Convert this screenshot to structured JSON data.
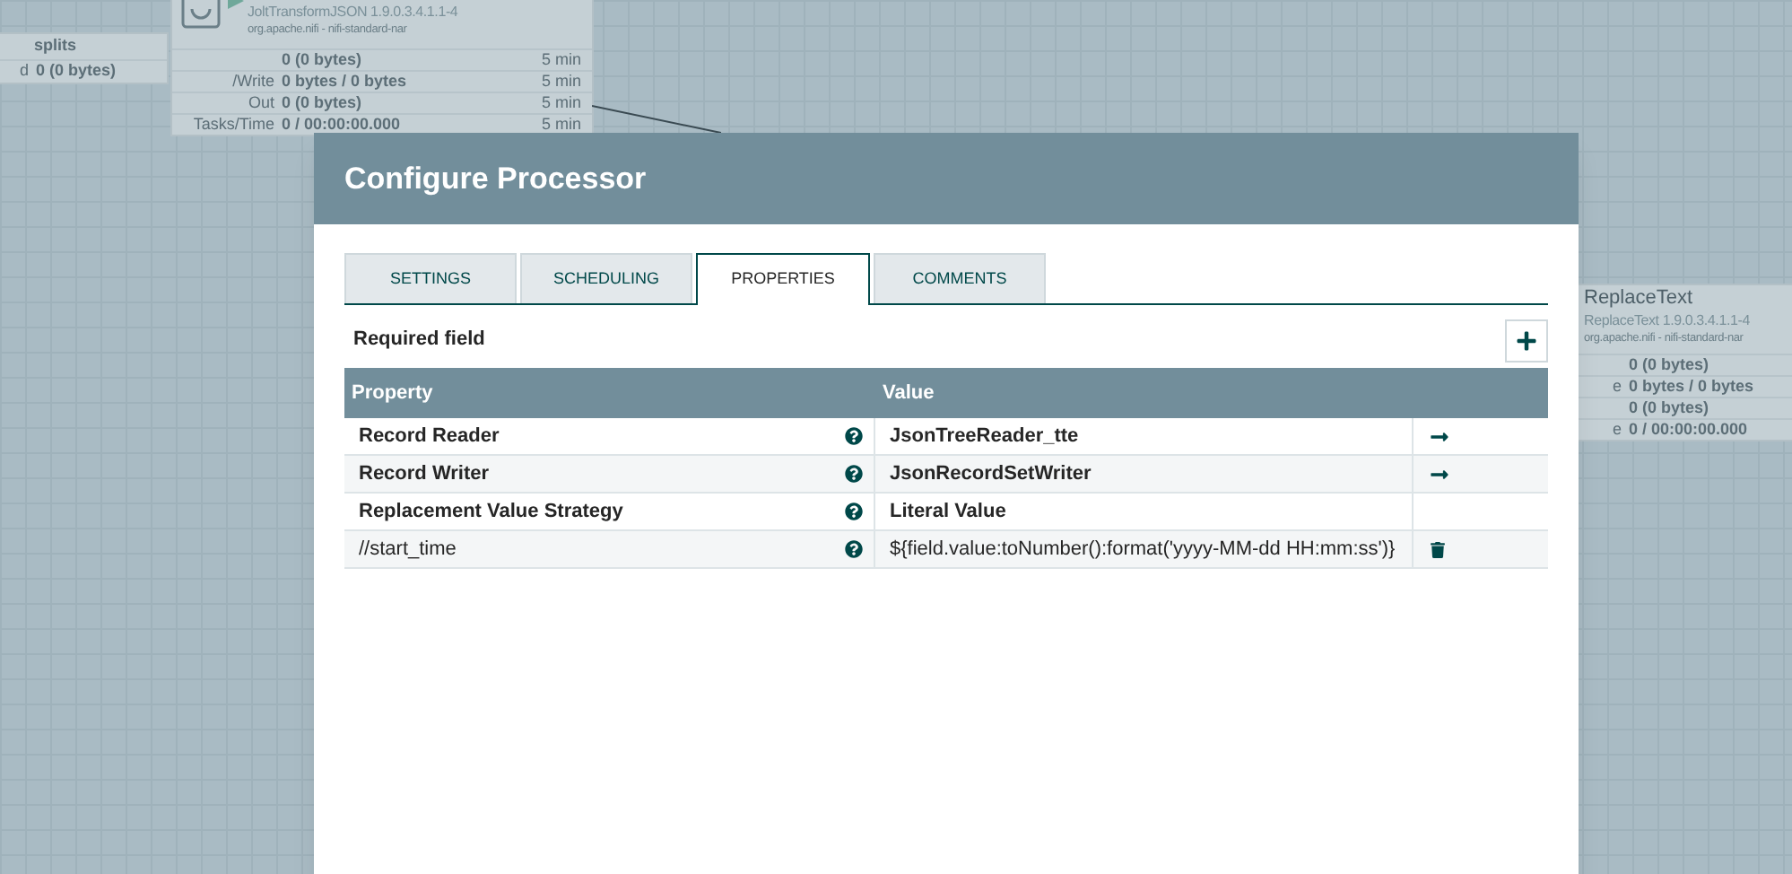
{
  "canvas": {
    "connection": {
      "name": "splits",
      "queued_label": "d",
      "queued_value": "0 (0 bytes)"
    },
    "processors": [
      {
        "type": "JoltTransformJSON 1.9.0.3.4.1.1-4",
        "bundle": "org.apache.nifi - nifi-standard-nar",
        "stats": [
          {
            "value": "0 (0 bytes)",
            "time": "5 min"
          },
          {
            "label": "/Write",
            "value": "0 bytes / 0 bytes",
            "time": "5 min"
          },
          {
            "label": "Out",
            "value": "0 (0 bytes)",
            "time": "5 min"
          },
          {
            "label": "Tasks/Time",
            "value": "0 / 00:00:00.000",
            "time": "5 min"
          }
        ]
      },
      {
        "name": "ReplaceText",
        "type": "ReplaceText 1.9.0.3.4.1.1-4",
        "bundle": "org.apache.nifi - nifi-standard-nar",
        "stats": [
          {
            "value": "0 (0 bytes)"
          },
          {
            "label": "e",
            "value": "0 bytes / 0 bytes"
          },
          {
            "value": "0 (0 bytes)"
          },
          {
            "label": "e",
            "value": "0 / 00:00:00.000"
          }
        ]
      }
    ]
  },
  "dialog": {
    "title": "Configure Processor",
    "tabs": [
      {
        "label": "SETTINGS",
        "selected": false
      },
      {
        "label": "SCHEDULING",
        "selected": false
      },
      {
        "label": "PROPERTIES",
        "selected": true
      },
      {
        "label": "COMMENTS",
        "selected": false
      }
    ],
    "required_note": "Required field",
    "table": {
      "columns": [
        "Property",
        "Value"
      ],
      "rows": [
        {
          "property": "Record Reader",
          "required": true,
          "value": "JsonTreeReader_tte",
          "has_link": true,
          "removable": false
        },
        {
          "property": "Record Writer",
          "required": true,
          "value": "JsonRecordSetWriter",
          "has_link": true,
          "removable": false
        },
        {
          "property": "Replacement Value Strategy",
          "required": true,
          "value": "Literal Value",
          "has_link": false,
          "removable": false
        },
        {
          "property": "//start_time",
          "required": false,
          "value": "${field.value:toNumber():format('yyyy-MM-dd HH:mm:ss')}",
          "has_link": false,
          "removable": true
        }
      ]
    }
  }
}
